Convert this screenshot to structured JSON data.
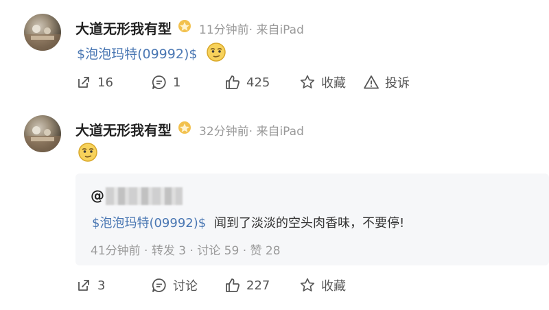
{
  "posts": [
    {
      "author": "大道无形我有型",
      "time": "11分钟前· 来自iPad",
      "stock_tag": "$泡泡玛特(09992)$",
      "emoji_icon": "smirk-emoji",
      "actions": {
        "repost": "16",
        "comment": "1",
        "like": "425",
        "favorite": "收藏",
        "report": "投诉"
      }
    },
    {
      "author": "大道无形我有型",
      "time": "32分钟前· 来自iPad",
      "emoji_icon": "smirk-emoji",
      "quote": {
        "at": "@",
        "stock_tag": "$泡泡玛特(09992)$",
        "text": "闻到了淡淡的空头肉香味，不要停!",
        "meta": "41分钟前 · 转发 3 · 讨论 59 · 赞 28"
      },
      "actions": {
        "repost": "3",
        "comment": "讨论",
        "like": "227",
        "favorite": "收藏"
      }
    }
  ],
  "colors": {
    "link": "#4a77b3",
    "meta": "#9a9a9a",
    "quote_bg": "#f6f7f9"
  }
}
